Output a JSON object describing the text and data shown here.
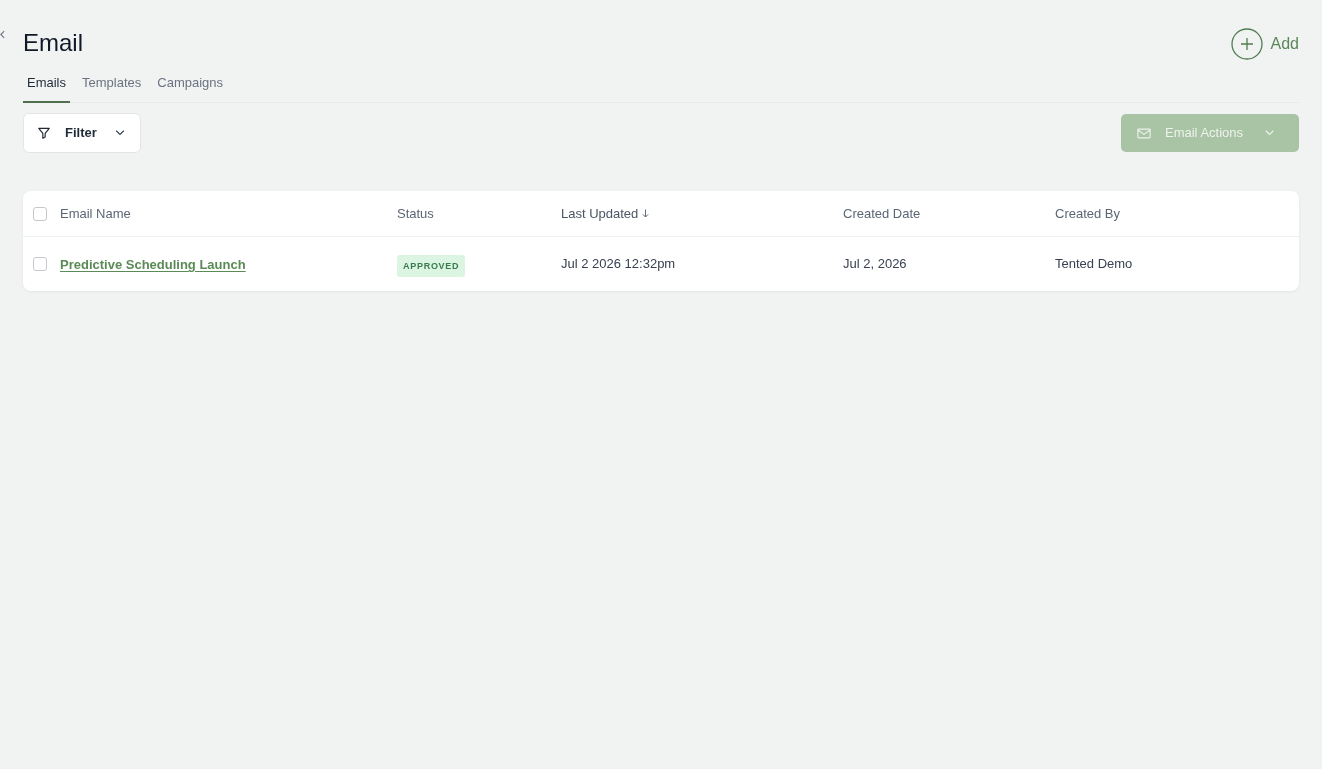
{
  "page": {
    "title": "Email",
    "add_button": {
      "label": "Add"
    }
  },
  "tabs": [
    {
      "label": "Emails",
      "selected": true
    },
    {
      "label": "Templates",
      "selected": false
    },
    {
      "label": "Campaigns",
      "selected": false
    }
  ],
  "toolbar": {
    "filter": {
      "label": "Filter"
    },
    "email_actions": {
      "label": "Email Actions",
      "disabled": true
    }
  },
  "table": {
    "select_all": {
      "checked": false
    },
    "columns": [
      {
        "label": "Email Name",
        "sorted": false
      },
      {
        "label": "Status",
        "sorted": false
      },
      {
        "label": "Last Updated",
        "sorted": true,
        "descending": true
      },
      {
        "label": "Created Date",
        "sorted": false
      },
      {
        "label": "Created By",
        "sorted": false
      }
    ],
    "rows": [
      {
        "checked": false,
        "email_name": "Predictive Scheduling Launch",
        "status": {
          "label": "APPROVED",
          "kind": "approved"
        },
        "last_updated": "Jul 2 2026 12:32pm",
        "created_date": "Jul 2, 2026",
        "created_by": "Tented Demo"
      }
    ]
  }
}
